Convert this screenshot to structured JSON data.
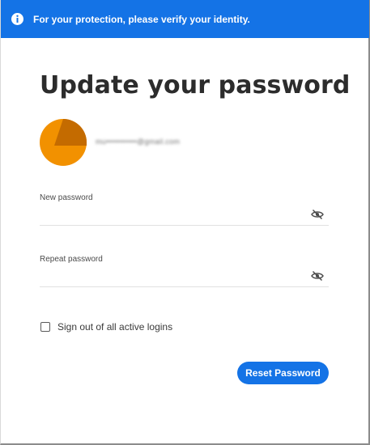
{
  "banner": {
    "icon": "info-icon",
    "text": "For your protection, please verify your identity.",
    "color": "#1473e6"
  },
  "page": {
    "title": "Update your password"
  },
  "account": {
    "avatar_icon": "avatar-triangle-icon",
    "avatar_color": "#f29100",
    "email": "mu•••••••••••@gmail.com"
  },
  "form": {
    "new_password_label": "New password",
    "new_password_value": "",
    "repeat_password_label": "Repeat password",
    "repeat_password_value": "",
    "visibility_icon": "eye-slash-icon",
    "signout_label": "Sign out of all active logins",
    "signout_checked": false,
    "submit_label": "Reset Password"
  }
}
